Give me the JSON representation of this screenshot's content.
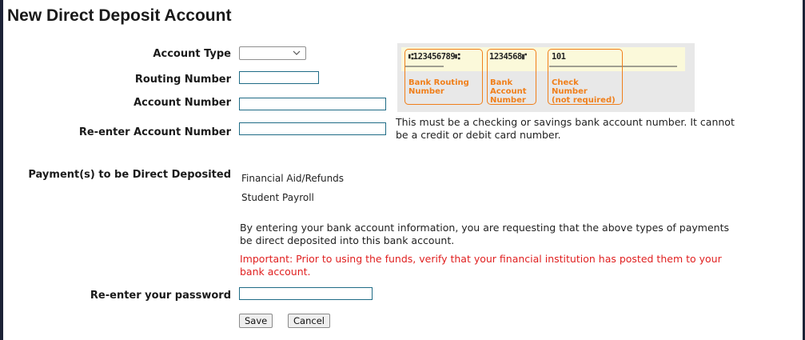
{
  "page": {
    "title": "New Direct Deposit Account"
  },
  "form": {
    "account_type_label": "Account Type",
    "account_type_value": "",
    "routing_number_label": "Routing Number",
    "routing_number_value": "",
    "account_number_label": "Account Number",
    "account_number_value": "",
    "reenter_account_label": "Re-enter Account Number",
    "reenter_account_value": "",
    "account_note_line1": "This must be a checking or savings bank account number. It cannot",
    "account_note_line2": "be a credit or debit card number.",
    "payments_label": "Payment(s) to be Direct Deposited",
    "payments": [
      "Financial Aid/Refunds",
      "Student Payroll"
    ],
    "consent_line1": "By entering your bank account information, you are requesting that the above types of payments",
    "consent_line2": "be direct deposited into this bank account.",
    "important_line1": "Important: Prior to using the funds, verify that your financial institution has posted them to your",
    "important_line2": "bank account.",
    "password_label": "Re-enter your password",
    "password_value": ""
  },
  "check_image": {
    "routing_digits": "⑆123456789⑆",
    "account_digits": "1234568⑈",
    "check_digits": "101",
    "routing_caption": [
      "Bank Routing",
      "Number"
    ],
    "account_caption": [
      "Bank",
      "Account",
      "Number"
    ],
    "check_caption": [
      "Check",
      "Number",
      "(not required)"
    ]
  },
  "buttons": {
    "save_label": "Save",
    "cancel_label": "Cancel"
  },
  "colors": {
    "background": "#1c2236",
    "panel": "#ffffff",
    "input_border": "#1f6c86",
    "check_highlight": "#f07f1a",
    "important_text": "#e02020"
  }
}
